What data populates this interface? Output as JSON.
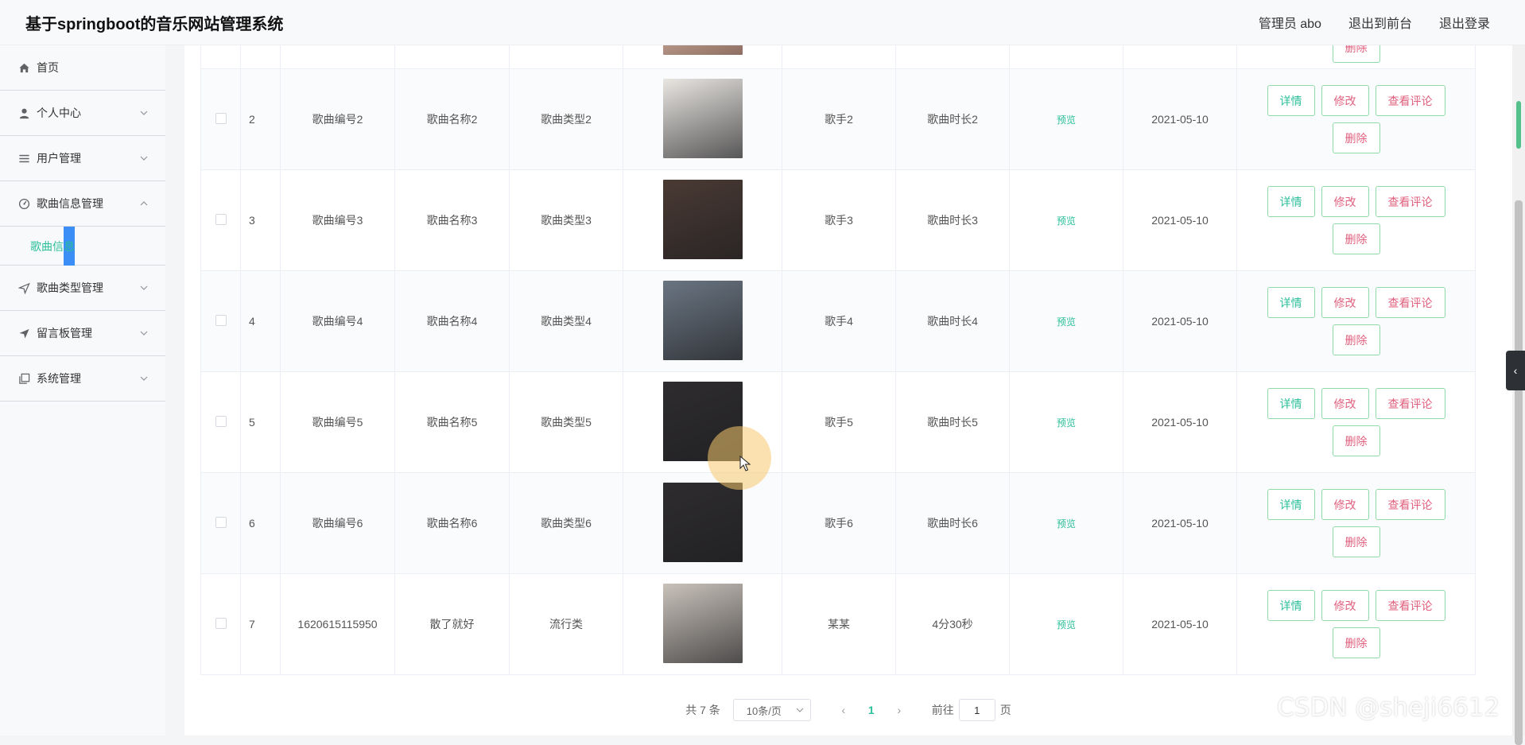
{
  "app": {
    "title": "基于springboot的音乐网站管理系统",
    "user_label": "管理员 abo",
    "exit_front": "退出到前台",
    "logout": "退出登录"
  },
  "sidebar": {
    "items": [
      {
        "label": "首页",
        "icon": "home-icon"
      },
      {
        "label": "个人中心",
        "icon": "user-icon"
      },
      {
        "label": "用户管理",
        "icon": "list-icon"
      },
      {
        "label": "歌曲信息管理",
        "icon": "dashboard-icon"
      },
      {
        "label": "歌曲类型管理",
        "icon": "send-icon"
      },
      {
        "label": "留言板管理",
        "icon": "paper-plane-icon"
      },
      {
        "label": "系统管理",
        "icon": "copy-icon"
      }
    ],
    "active_sub": "歌曲信息"
  },
  "table": {
    "partial_row_button": "删除",
    "rows": [
      {
        "index": "2",
        "code": "歌曲编号2",
        "name": "歌曲名称2",
        "type": "歌曲类型2",
        "singer": "歌手2",
        "duration": "歌曲时长2",
        "preview": "预览",
        "date": "2021-05-10",
        "thumb_color": "#e9e6e2"
      },
      {
        "index": "3",
        "code": "歌曲编号3",
        "name": "歌曲名称3",
        "type": "歌曲类型3",
        "singer": "歌手3",
        "duration": "歌曲时长3",
        "preview": "预览",
        "date": "2021-05-10",
        "thumb_color": "#4a3a34"
      },
      {
        "index": "4",
        "code": "歌曲编号4",
        "name": "歌曲名称4",
        "type": "歌曲类型4",
        "singer": "歌手4",
        "duration": "歌曲时长4",
        "preview": "预览",
        "date": "2021-05-10",
        "thumb_color": "#6a7582"
      },
      {
        "index": "5",
        "code": "歌曲编号5",
        "name": "歌曲名称5",
        "type": "歌曲类型5",
        "singer": "歌手5",
        "duration": "歌曲时长5",
        "preview": "预览",
        "date": "2021-05-10",
        "thumb_color": "#2e2c2e"
      },
      {
        "index": "6",
        "code": "歌曲编号6",
        "name": "歌曲名称6",
        "type": "歌曲类型6",
        "singer": "歌手6",
        "duration": "歌曲时长6",
        "preview": "预览",
        "date": "2021-05-10",
        "thumb_color": "#2e2c2e"
      },
      {
        "index": "7",
        "code": "1620615115950",
        "name": "散了就好",
        "type": "流行类",
        "singer": "某某",
        "duration": "4分30秒",
        "preview": "预览",
        "date": "2021-05-10",
        "thumb_color": "#c9c2bb"
      }
    ],
    "buttons": {
      "detail": "详情",
      "edit": "修改",
      "comment": "查看评论",
      "delete": "删除"
    }
  },
  "pager": {
    "total": "共 7 条",
    "page_size": "10条/页",
    "current": "1",
    "goto_prefix": "前往",
    "goto_value": "1",
    "goto_suffix": "页"
  },
  "watermark": "CSDN @sheji6612"
}
